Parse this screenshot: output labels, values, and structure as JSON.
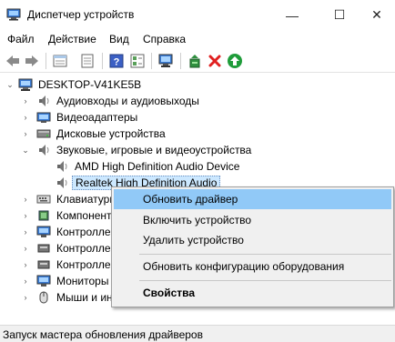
{
  "window": {
    "title": "Диспетчер устройств",
    "minimize": "—",
    "maximize": "☐",
    "close": "✕"
  },
  "menu": [
    "Файл",
    "Действие",
    "Вид",
    "Справка"
  ],
  "toolbar": {
    "icons": [
      "back-icon",
      "forward-icon",
      "properties-sheet-icon",
      "show-hidden-icon",
      "help-icon",
      "device-view-icon",
      "scan-hardware-icon",
      "update-driver-icon",
      "uninstall-icon",
      "enable-device-icon"
    ]
  },
  "tree": {
    "root": "DESKTOP-V41KE5B",
    "categories": [
      {
        "label": "Аудиовходы и аудиовыходы",
        "icon": "speaker-icon",
        "expander": "›"
      },
      {
        "label": "Видеоадаптеры",
        "icon": "display-adapter-icon",
        "expander": "›"
      },
      {
        "label": "Дисковые устройства",
        "icon": "disk-icon",
        "expander": "›"
      },
      {
        "label": "Звуковые, игровые и видеоустройства",
        "icon": "speaker-icon",
        "expander": "⌄"
      },
      {
        "label": "AMD High Definition Audio Device",
        "icon": "speaker-icon",
        "child": true
      },
      {
        "label": "Realtek High Definition Audio",
        "icon": "speaker-icon",
        "child": true,
        "selected": true
      },
      {
        "label": "Клавиатуры",
        "icon": "keyboard-icon",
        "expander": "›"
      },
      {
        "label": "Компоненты программного обеспечения",
        "icon": "component-icon",
        "expander": "›"
      },
      {
        "label": "Контроллеры IDE ATA/ATAPI",
        "icon": "monitor-icon",
        "expander": "›"
      },
      {
        "label": "Контроллеры запоминающих устройств",
        "icon": "controller-icon",
        "expander": "›"
      },
      {
        "label": "Контроллеры USB",
        "icon": "controller-icon",
        "expander": "›"
      },
      {
        "label": "Мониторы",
        "icon": "monitor-icon",
        "expander": "›"
      },
      {
        "label": "Мыши и иные указывающие устройства",
        "icon": "mouse-icon",
        "expander": "›"
      }
    ]
  },
  "context_menu": {
    "items": [
      {
        "label": "Обновить драйвер",
        "highlighted": true
      },
      {
        "label": "Включить устройство"
      },
      {
        "label": "Удалить устройство"
      },
      {
        "label": "Обновить конфигурацию оборудования"
      },
      {
        "label": "Свойства",
        "bold": true
      }
    ]
  },
  "status": {
    "text": "Запуск мастера обновления драйверов"
  }
}
